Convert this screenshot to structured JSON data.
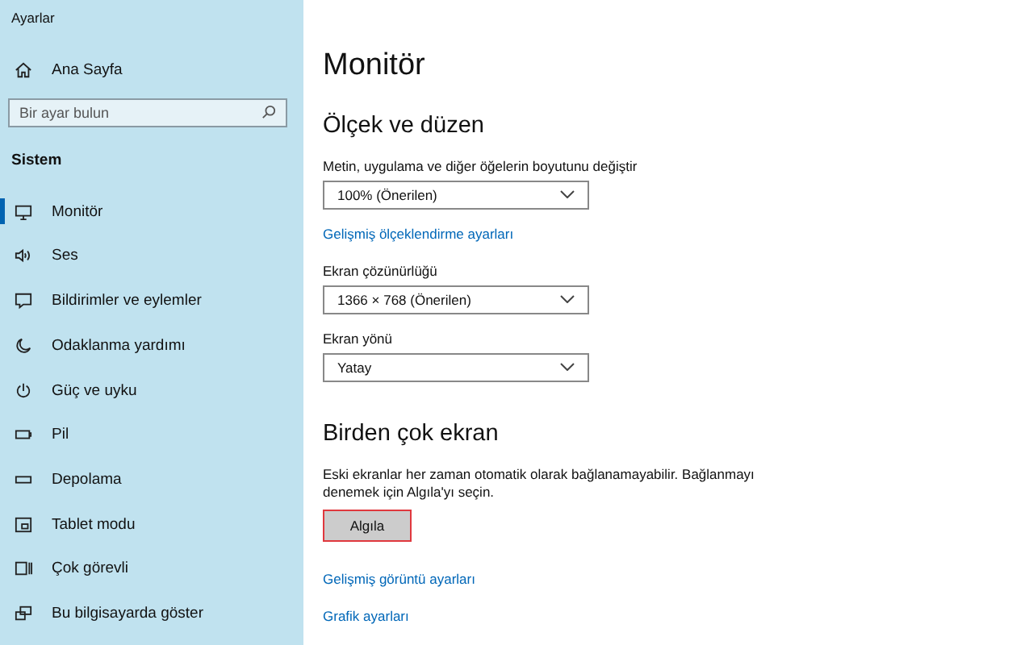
{
  "window": {
    "title": "Ayarlar"
  },
  "sidebar": {
    "home": "Ana Sayfa",
    "search": {
      "placeholder": "Bir ayar bulun"
    },
    "section": "Sistem",
    "items": [
      {
        "label": "Monitör",
        "selected": true
      },
      {
        "label": "Ses",
        "selected": false
      },
      {
        "label": "Bildirimler ve eylemler",
        "selected": false
      },
      {
        "label": "Odaklanma yardımı",
        "selected": false
      },
      {
        "label": "Güç ve uyku",
        "selected": false
      },
      {
        "label": "Pil",
        "selected": false
      },
      {
        "label": "Depolama",
        "selected": false
      },
      {
        "label": "Tablet modu",
        "selected": false
      },
      {
        "label": "Çok görevli",
        "selected": false
      },
      {
        "label": "Bu bilgisayarda göster",
        "selected": false
      }
    ]
  },
  "main": {
    "title": "Monitör",
    "sections": [
      {
        "heading": "Ölçek ve düzen",
        "items": [
          {
            "kind": "dropdown",
            "label": "Metin, uygulama ve diğer öğelerin boyutunu değiştir",
            "value": "100% (Önerilen)"
          },
          {
            "kind": "link",
            "text": "Gelişmiş ölçeklendirme ayarları"
          },
          {
            "kind": "dropdown",
            "label": "Ekran çözünürlüğü",
            "value": "1366 × 768 (Önerilen)"
          },
          {
            "kind": "dropdown",
            "label": "Ekran yönü",
            "value": "Yatay"
          }
        ]
      },
      {
        "heading": "Birden çok ekran",
        "items": [
          {
            "kind": "text",
            "text": "Eski ekranlar her zaman otomatik olarak bağlanamayabilir. Bağlanmayı denemek için Algıla'yı seçin."
          },
          {
            "kind": "button",
            "text": "Algıla",
            "highlighted": true
          },
          {
            "kind": "link",
            "text": "Gelişmiş görüntü ayarları"
          },
          {
            "kind": "link",
            "text": "Grafik ayarları"
          }
        ]
      }
    ]
  }
}
